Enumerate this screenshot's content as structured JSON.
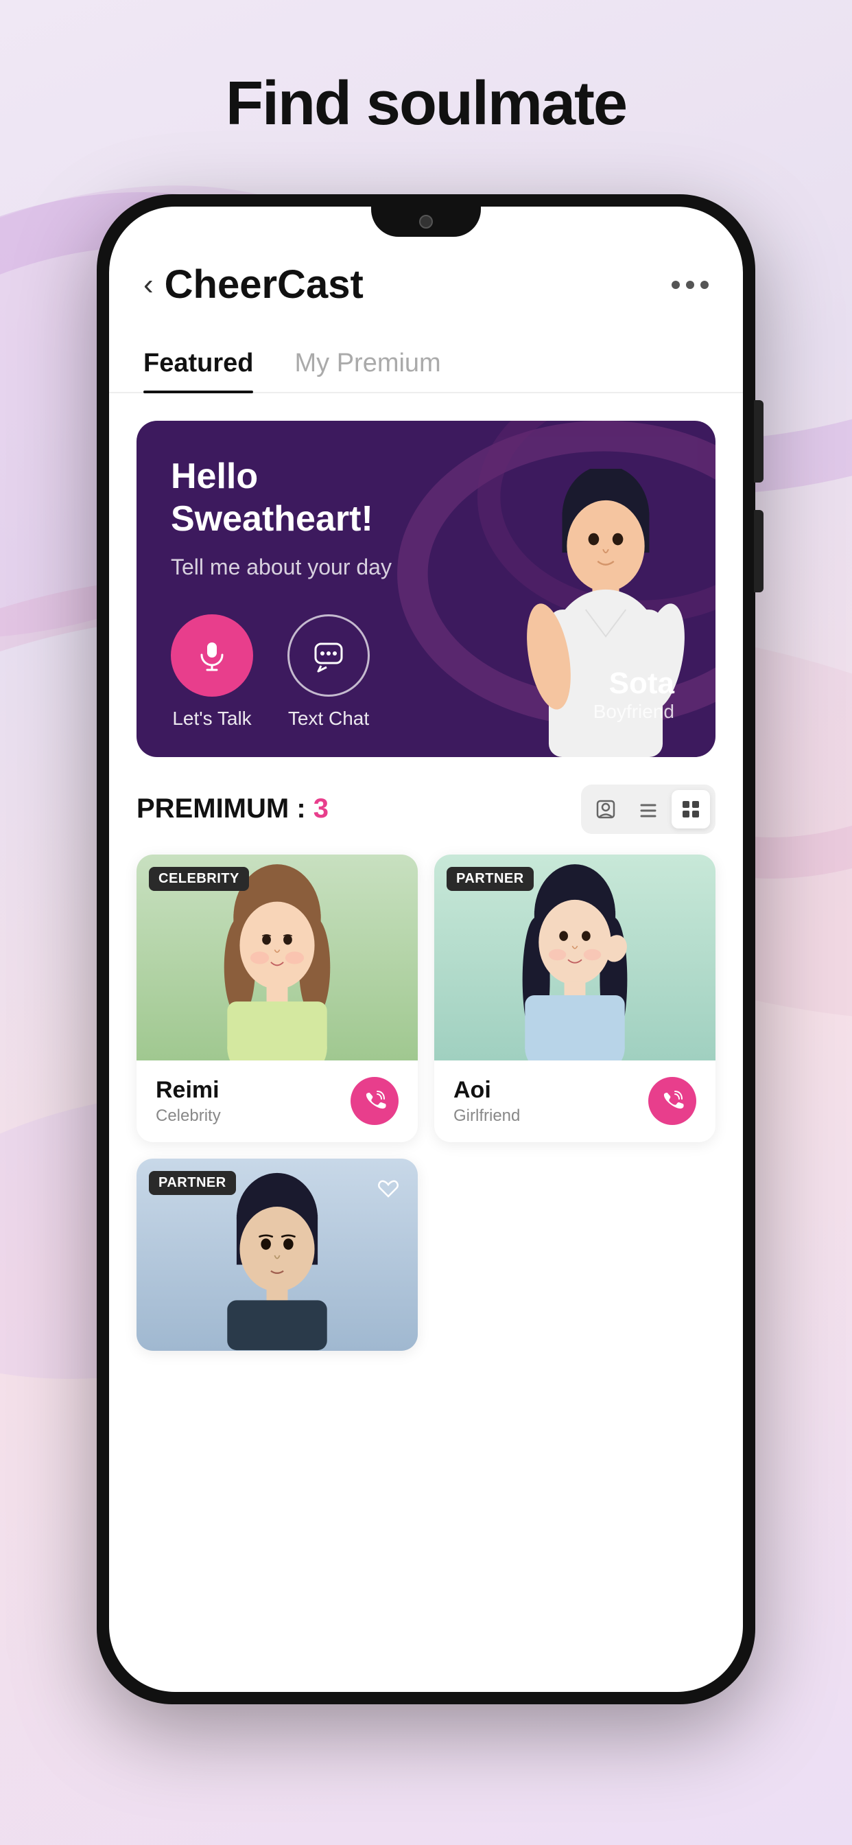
{
  "page": {
    "title": "Find soulmate"
  },
  "app": {
    "name": "CheerCast",
    "back_label": "‹",
    "more_icon": "···"
  },
  "tabs": [
    {
      "id": "featured",
      "label": "Featured",
      "active": true
    },
    {
      "id": "premium",
      "label": "My Premium",
      "active": false
    }
  ],
  "banner": {
    "greeting_line1": "Hello",
    "greeting_line2": "Sweatheart!",
    "subtitle": "Tell me about your day",
    "actions": [
      {
        "id": "talk",
        "label": "Let's Talk"
      },
      {
        "id": "chat",
        "label": "Text Chat"
      }
    ],
    "person_name": "Sota",
    "person_role": "Boyfriend"
  },
  "premium": {
    "label": "PREMIMUM :",
    "count": "3"
  },
  "cards": [
    {
      "id": "reimi",
      "badge": "CELEBRITY",
      "name": "Reimi",
      "role": "Celebrity",
      "has_heart": false,
      "has_call": true,
      "theme": "green"
    },
    {
      "id": "aoi",
      "badge": "PARTNER",
      "name": "Aoi",
      "role": "Girlfriend",
      "has_heart": false,
      "has_call": true,
      "theme": "teal"
    },
    {
      "id": "male3",
      "badge": "PARTNER",
      "name": "",
      "role": "",
      "has_heart": true,
      "has_call": false,
      "theme": "blue"
    }
  ],
  "colors": {
    "accent": "#e83e8c",
    "dark_purple": "#3d1a5e",
    "text_primary": "#111111",
    "text_secondary": "#888888"
  }
}
